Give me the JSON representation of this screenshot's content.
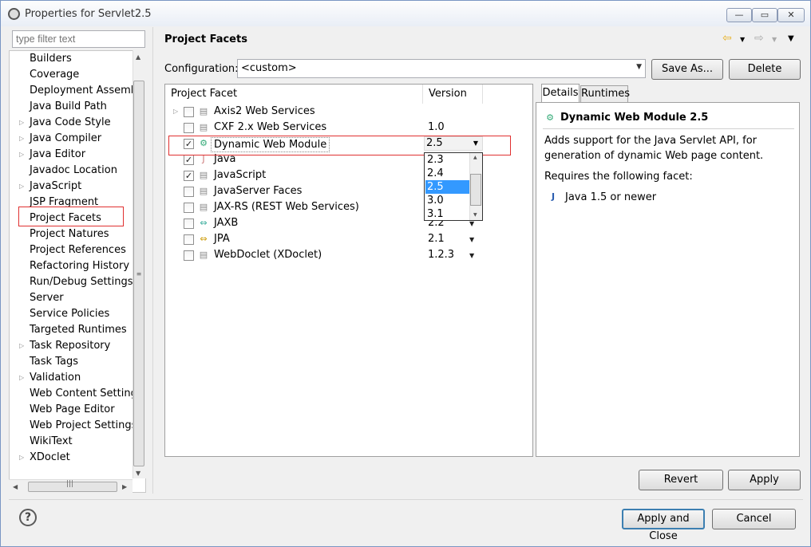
{
  "window": {
    "title": "Properties for Servlet2.5",
    "controls": {
      "minimize": "—",
      "maximize": "▭",
      "close": "✕"
    }
  },
  "filter": {
    "placeholder": "type filter text"
  },
  "tree": {
    "items": [
      {
        "label": "Builders",
        "expandable": false
      },
      {
        "label": "Coverage",
        "expandable": false
      },
      {
        "label": "Deployment Assembly",
        "expandable": false
      },
      {
        "label": "Java Build Path",
        "expandable": false
      },
      {
        "label": "Java Code Style",
        "expandable": true
      },
      {
        "label": "Java Compiler",
        "expandable": true
      },
      {
        "label": "Java Editor",
        "expandable": true
      },
      {
        "label": "Javadoc Location",
        "expandable": false
      },
      {
        "label": "JavaScript",
        "expandable": true
      },
      {
        "label": "JSP Fragment",
        "expandable": false
      },
      {
        "label": "Project Facets",
        "expandable": false
      },
      {
        "label": "Project Natures",
        "expandable": false
      },
      {
        "label": "Project References",
        "expandable": false
      },
      {
        "label": "Refactoring History",
        "expandable": false
      },
      {
        "label": "Run/Debug Settings",
        "expandable": false
      },
      {
        "label": "Server",
        "expandable": false
      },
      {
        "label": "Service Policies",
        "expandable": false
      },
      {
        "label": "Targeted Runtimes",
        "expandable": false
      },
      {
        "label": "Task Repository",
        "expandable": true
      },
      {
        "label": "Task Tags",
        "expandable": false
      },
      {
        "label": "Validation",
        "expandable": true
      },
      {
        "label": "Web Content Settings",
        "expandable": false
      },
      {
        "label": "Web Page Editor",
        "expandable": false
      },
      {
        "label": "Web Project Settings",
        "expandable": false
      },
      {
        "label": "WikiText",
        "expandable": false
      },
      {
        "label": "XDoclet",
        "expandable": true
      }
    ],
    "selected": "Project Facets"
  },
  "page": {
    "title": "Project Facets",
    "configuration_label": "Configuration:",
    "configuration_value": "<custom>",
    "save_as_label": "Save As...",
    "delete_label": "Delete"
  },
  "facets": {
    "col_facet": "Project Facet",
    "col_version": "Version",
    "rows": [
      {
        "name": "Axis2 Web Services",
        "checked": false,
        "version": "",
        "icon": "page-icon",
        "expandable": true
      },
      {
        "name": "CXF 2.x Web Services",
        "checked": false,
        "version": "1.0",
        "icon": "page-icon",
        "expandable": false
      },
      {
        "name": "Dynamic Web Module",
        "checked": true,
        "version": "2.5",
        "icon": "web-module-icon",
        "expandable": false
      },
      {
        "name": "Java",
        "checked": true,
        "version": "",
        "icon": "java-lock-icon",
        "expandable": false
      },
      {
        "name": "JavaScript",
        "checked": true,
        "version": "",
        "icon": "page-icon",
        "expandable": false
      },
      {
        "name": "JavaServer Faces",
        "checked": false,
        "version": "",
        "icon": "page-icon",
        "expandable": false
      },
      {
        "name": "JAX-RS (REST Web Services)",
        "checked": false,
        "version": "",
        "icon": "page-icon",
        "expandable": false
      },
      {
        "name": "JAXB",
        "checked": false,
        "version": "2.2",
        "icon": "jaxb-icon",
        "expandable": false
      },
      {
        "name": "JPA",
        "checked": false,
        "version": "2.1",
        "icon": "jpa-icon",
        "expandable": false
      },
      {
        "name": "WebDoclet (XDoclet)",
        "checked": false,
        "version": "1.2.3",
        "icon": "page-icon",
        "expandable": false
      }
    ],
    "version_popup": {
      "options": [
        "2.3",
        "2.4",
        "2.5",
        "3.0",
        "3.1"
      ],
      "selected": "2.5"
    }
  },
  "details": {
    "tabs": [
      "Details",
      "Runtimes"
    ],
    "active_tab": "Details",
    "title": "Dynamic Web Module 2.5",
    "description_line1": "Adds support for the Java Servlet API, for",
    "description_line2": "generation of dynamic Web page content.",
    "requires_label": "Requires the following facet:",
    "requirement": "Java 1.5 or newer"
  },
  "buttons": {
    "revert": "Revert",
    "apply": "Apply",
    "apply_close": "Apply and Close",
    "cancel": "Cancel",
    "help": "?"
  },
  "colors": {
    "highlight_border": "#e03030",
    "selection": "#3399ff",
    "default_button_border": "#3c7fb1"
  }
}
